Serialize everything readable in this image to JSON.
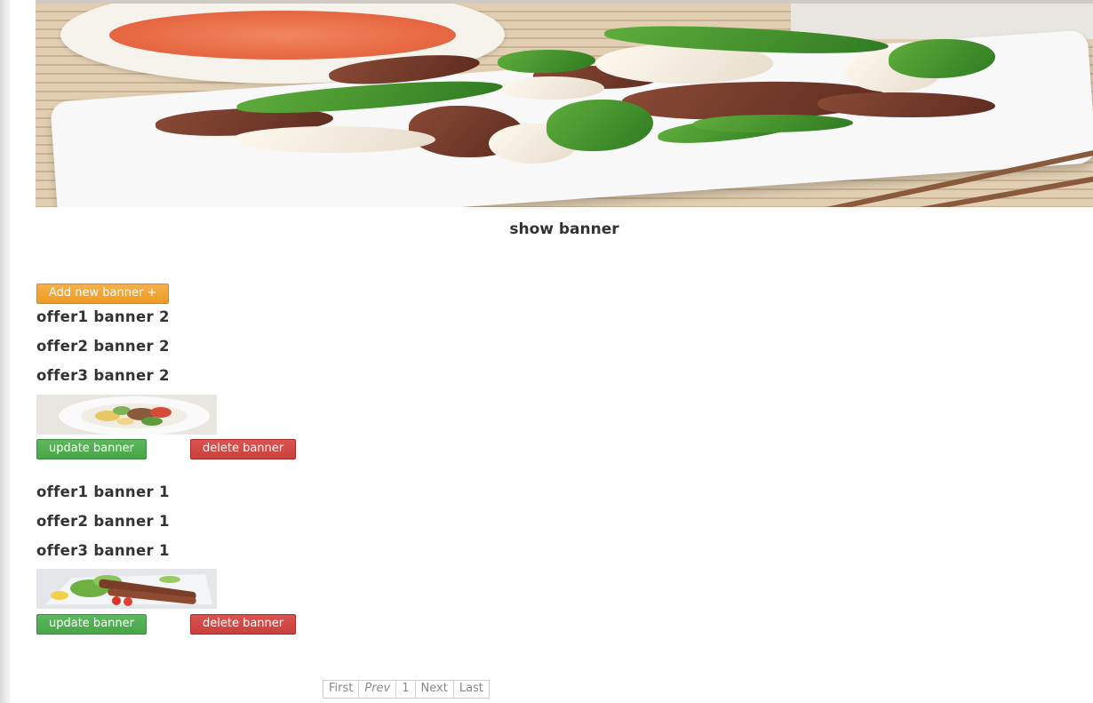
{
  "page": {
    "title": "show banner"
  },
  "toolbar": {
    "add_label": "Add new banner +"
  },
  "banners": [
    {
      "offers": [
        "offer1 banner 2",
        "offer2 banner 2",
        "offer3 banner 2"
      ],
      "update_label": "update banner",
      "delete_label": "delete banner"
    },
    {
      "offers": [
        "offer1 banner 1",
        "offer2 banner 1",
        "offer3 banner 1"
      ],
      "update_label": "update banner",
      "delete_label": "delete banner"
    }
  ],
  "pagination": {
    "first": "First",
    "prev": "Prev",
    "page": "1",
    "next": "Next",
    "last": "Last"
  },
  "colors": {
    "add_button": "#ee9a22",
    "update_button": "#5cb85c",
    "delete_button": "#d9534f"
  }
}
